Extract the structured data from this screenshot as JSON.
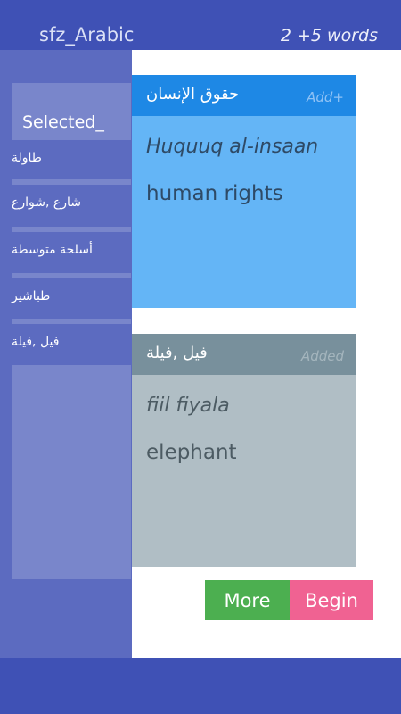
{
  "header": {
    "title": "sfz_Arabic",
    "word_count": "2  +5 words"
  },
  "sidebar": {
    "selected_label": "Selected_",
    "items": [
      {
        "label": "طاولة"
      },
      {
        "label": "شارع ,شوارع"
      },
      {
        "label": "أسلحة متوسطة"
      },
      {
        "label": "طباشير"
      },
      {
        "label": "فيل ,فيلة"
      }
    ]
  },
  "cards": [
    {
      "word": "حقوق الإنسان",
      "action": "Add+",
      "transliteration": "Huquuq al-insaan",
      "meaning": "human rights"
    },
    {
      "word": "فيل ,فيلة",
      "action": "Added",
      "transliteration": "fiil fiyala",
      "meaning": "elephant"
    }
  ],
  "actions": {
    "more_label": "More",
    "begin_label": "Begin"
  },
  "colors": {
    "primary": "#3f51b5",
    "sidebar": "#5c6bc0",
    "sidebar_light": "#7986cb",
    "card_new_header": "#1e88e5",
    "card_new_body": "#64b5f6",
    "card_added_header": "#78909c",
    "card_added_body": "#b0bec5",
    "more_button": "#4caf50",
    "begin_button": "#f06292"
  }
}
